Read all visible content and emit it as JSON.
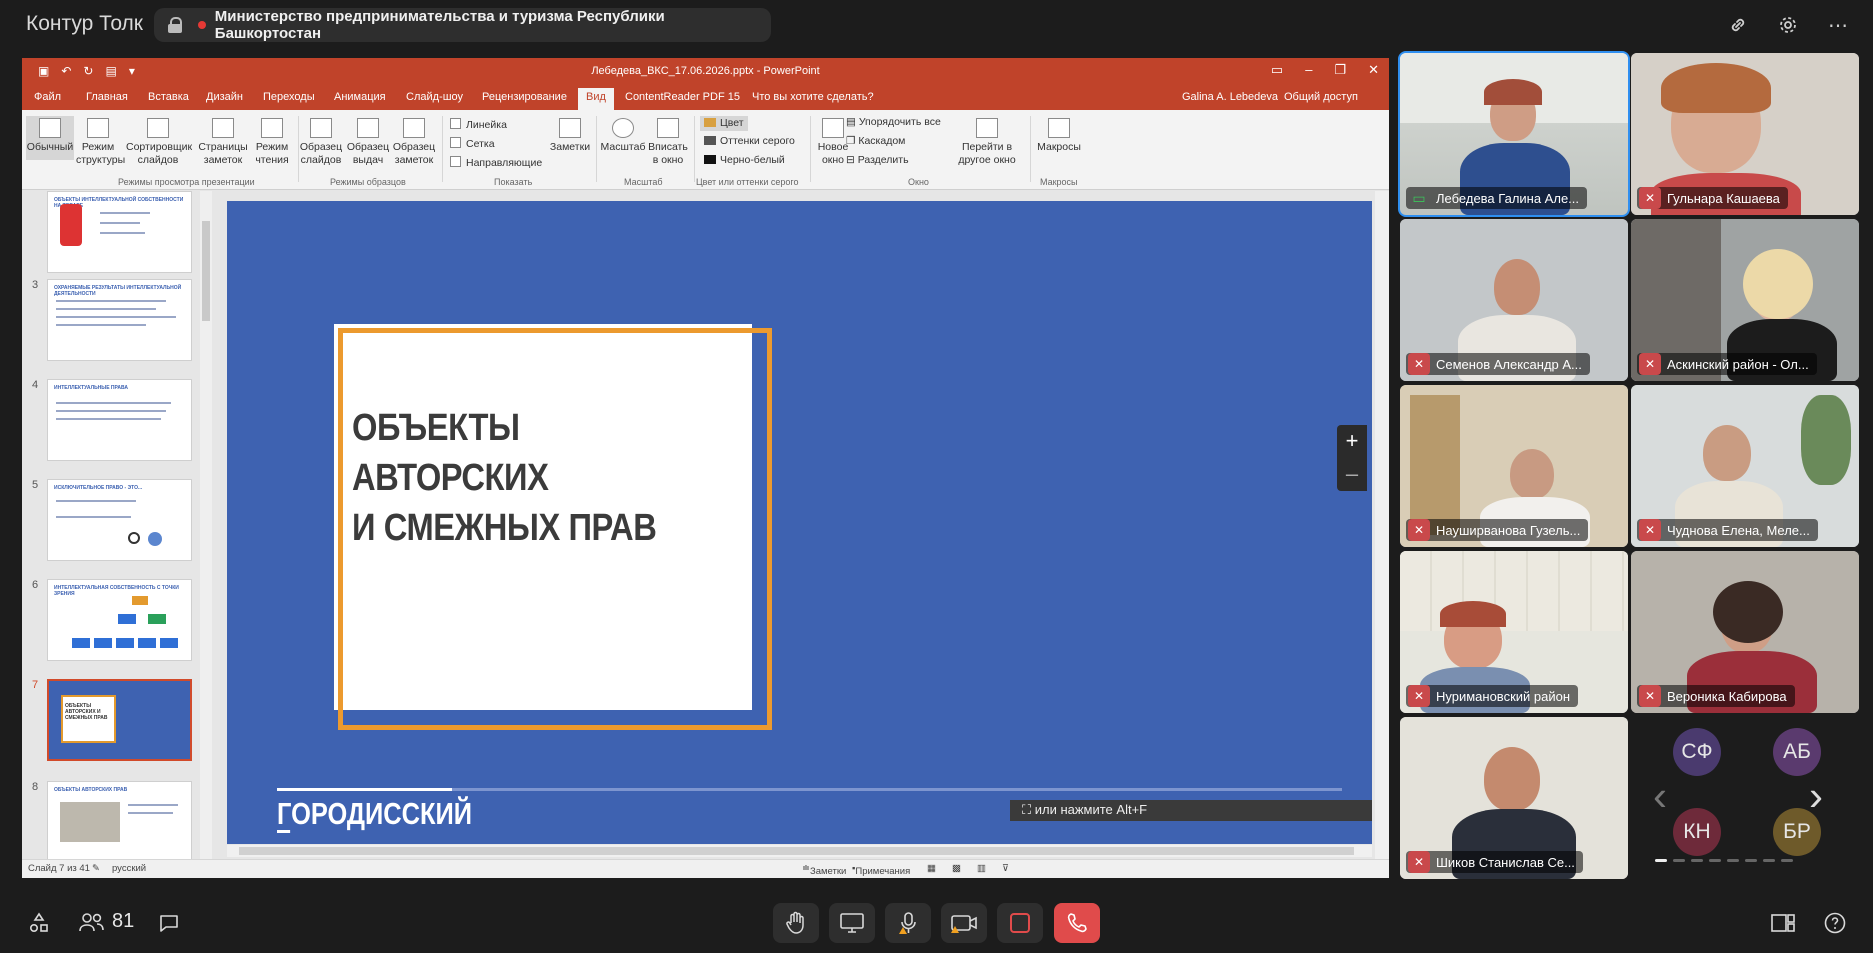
{
  "app": {
    "title": "Контур Толк"
  },
  "meeting": {
    "title": "Министерство предпринимательства и туризма Республики Башкортостан"
  },
  "top_icons": [
    "link-icon",
    "gear-icon",
    "more-icon"
  ],
  "powerpoint": {
    "document_title": "Лебедева_ВКС_17.06.2026.pptx - PowerPoint",
    "tabs": [
      "Файл",
      "Главная",
      "Вставка",
      "Дизайн",
      "Переходы",
      "Анимация",
      "Слайд-шоу",
      "Рецензирование",
      "Вид",
      "ContentReader PDF 15",
      "Что вы хотите сделать?"
    ],
    "active_tab": "Вид",
    "user": "Galina A. Lebedeva",
    "share": "Общий доступ",
    "ribbon": {
      "views": [
        "Обычный",
        "Режим структуры",
        "Сортировщик слайдов",
        "Страницы заметок",
        "Режим чтения"
      ],
      "views_group": "Режимы просмотра презентации",
      "masters": [
        "Образец слайдов",
        "Образец выдач",
        "Образец заметок"
      ],
      "masters_group": "Режимы образцов",
      "show": [
        "Линейка",
        "Сетка",
        "Направляющие"
      ],
      "notes": "Заметки",
      "show_group": "Показать",
      "zoom": [
        "Масштаб",
        "Вписать в окно"
      ],
      "zoom_group": "Масштаб",
      "color": [
        "Цвет",
        "Оттенки серого",
        "Черно-белый"
      ],
      "color_group": "Цвет или оттенки серого",
      "window": [
        "Новое окно",
        "Упорядочить все",
        "Каскадом",
        "Разделить",
        "Перейти в другое окно"
      ],
      "window_group": "Окно",
      "macros": "Макросы",
      "macros_group": "Макросы"
    },
    "thumbnails": [
      {
        "num": "",
        "title": "ОБЪЕКТЫ ИНТЕЛЛЕКТУАЛЬНОЙ СОБСТВЕННОСТИ НА ТОВАРЕ"
      },
      {
        "num": "3",
        "title": "ОХРАНЯЕМЫЕ РЕЗУЛЬТАТЫ ИНТЕЛЛЕКТУАЛЬНОЙ ДЕЯТЕЛЬНОСТИ"
      },
      {
        "num": "4",
        "title": "ИНТЕЛЛЕКТУАЛЬНЫЕ ПРАВА"
      },
      {
        "num": "5",
        "title": "ИСКЛЮЧИТЕЛЬНОЕ ПРАВО - ЭТО..."
      },
      {
        "num": "6",
        "title": "ИНТЕЛЛЕКТУАЛЬНАЯ СОБСТВЕННОСТЬ С ТОЧКИ ЗРЕНИЯ"
      },
      {
        "num": "7",
        "title": "ОБЪЕКТЫ АВТОРСКИХ И СМЕЖНЫХ ПРАВ"
      },
      {
        "num": "8",
        "title": "ОБЪЕКТЫ АВТОРСКИХ ПРАВ"
      }
    ],
    "slide": {
      "title_line1": "ОБЪЕКТЫ АВТОРСКИХ",
      "title_line2": "И СМЕЖНЫХ ПРАВ",
      "logo": "ГОРОДИССКИЙ",
      "number": "7"
    },
    "status": {
      "slide_of": "Слайд 7 из 41",
      "language": "русский",
      "notes": "Заметки",
      "comments": "Примечания"
    },
    "hint": "или нажмите Alt+F"
  },
  "participants": [
    {
      "name": "Лебедева Галина Але...",
      "speaking": true,
      "sharing": true
    },
    {
      "name": "Гульнара Кашаева",
      "speaking": false,
      "sharing": false
    },
    {
      "name": "Семенов Александр А...",
      "speaking": false,
      "sharing": false
    },
    {
      "name": "Аскинский район - Ол...",
      "speaking": false,
      "sharing": false
    },
    {
      "name": "Науширванова Гузель...",
      "speaking": false,
      "sharing": false
    },
    {
      "name": "Чуднова Елена, Меле...",
      "speaking": false,
      "sharing": false
    },
    {
      "name": "Нуримановский район",
      "speaking": false,
      "sharing": false
    },
    {
      "name": "Вероника Кабирова",
      "speaking": false,
      "sharing": false
    },
    {
      "name": "Шиков Станислав Се...",
      "speaking": false,
      "sharing": false
    }
  ],
  "avatars": [
    {
      "initials": "СФ",
      "color": "#4a3a6e"
    },
    {
      "initials": "АБ",
      "color": "#5a3a6e"
    },
    {
      "initials": "КН",
      "color": "#6e2a3a"
    },
    {
      "initials": "БР",
      "color": "#6e5a2a"
    }
  ],
  "bottom": {
    "participants_count": "81"
  }
}
